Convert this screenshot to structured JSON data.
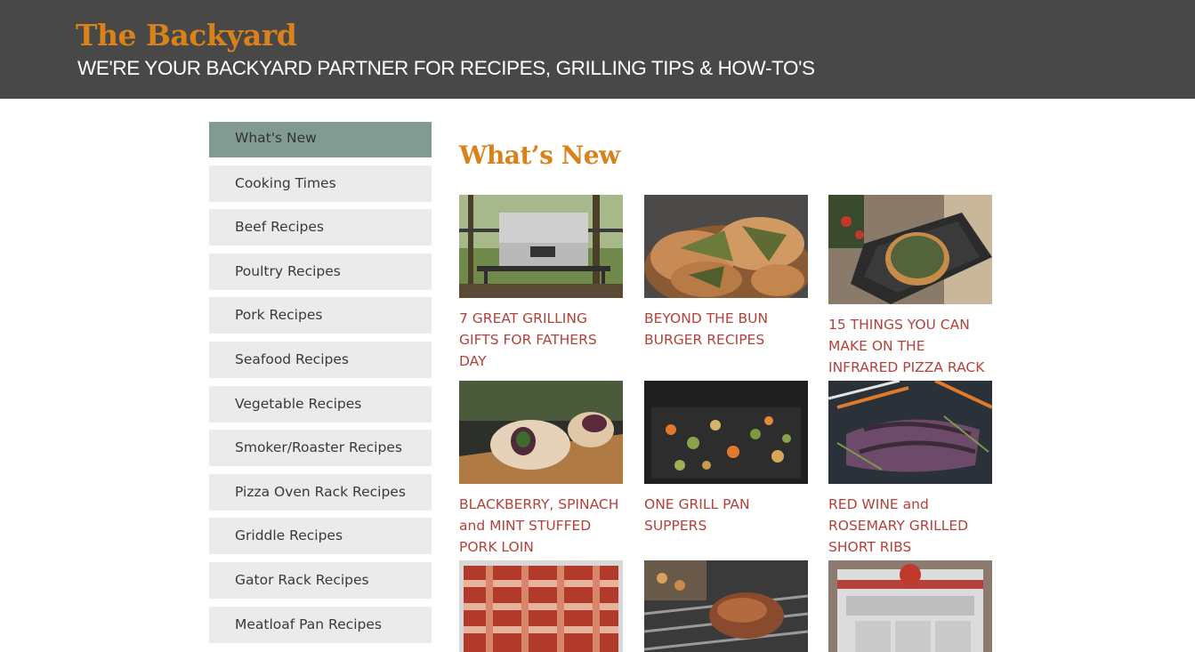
{
  "header": {
    "title": "The Backyard",
    "tagline": "WE'RE YOUR BACKYARD PARTNER FOR RECIPES, GRILLING TIPS & HOW-TO'S"
  },
  "sidebar": {
    "items": [
      {
        "label": "What's New",
        "active": true
      },
      {
        "label": "Cooking Times"
      },
      {
        "label": "Beef Recipes"
      },
      {
        "label": "Poultry Recipes"
      },
      {
        "label": "Pork Recipes"
      },
      {
        "label": "Seafood Recipes"
      },
      {
        "label": "Vegetable Recipes"
      },
      {
        "label": "Smoker/Roaster Recipes"
      },
      {
        "label": "Pizza Oven Rack Recipes"
      },
      {
        "label": "Griddle Recipes"
      },
      {
        "label": "Gator Rack Recipes"
      },
      {
        "label": "Meatloaf Pan Recipes"
      }
    ]
  },
  "main": {
    "title": "What’s New",
    "articles": [
      {
        "title": "7 GREAT GRILLING GIFTS FOR FATHERS DAY",
        "image": "grill-on-deck"
      },
      {
        "title": "BEYOND THE BUN BURGER RECIPES",
        "image": "stuffed-flatbread"
      },
      {
        "title": "15 THINGS YOU CAN MAKE ON THE INFRARED PIZZA RACK",
        "image": "pizza-on-rack"
      },
      {
        "title": "BLACKBERRY, SPINACH and MINT STUFFED PORK LOIN",
        "image": "stuffed-pork-loin"
      },
      {
        "title": "ONE GRILL PAN SUPPERS",
        "image": "vegetables-grill-pan"
      },
      {
        "title": "RED WINE and ROSEMARY GRILLED SHORT RIBS",
        "image": "short-ribs-rosemary"
      },
      {
        "title": "",
        "image": "bacon-weave"
      },
      {
        "title": "",
        "image": "roast-on-grill"
      },
      {
        "title": "",
        "image": "grill-with-bow"
      }
    ]
  }
}
